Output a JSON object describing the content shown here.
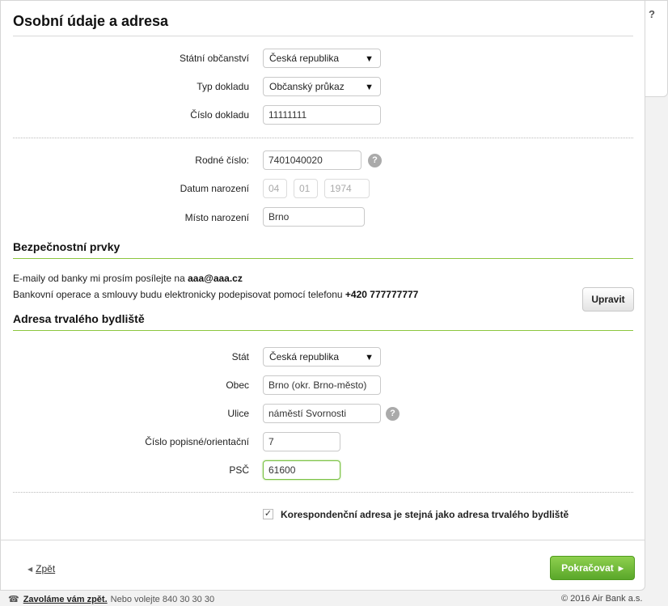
{
  "header": {
    "title": "Osobní údaje a adresa",
    "help": "?"
  },
  "document": {
    "citizenship_label": "Státní občanství",
    "citizenship_value": "Česká republika",
    "doctype_label": "Typ dokladu",
    "doctype_value": "Občanský průkaz",
    "docnum_label": "Číslo dokladu",
    "docnum_value": "11111111"
  },
  "personal": {
    "birthnum_label": "Rodné číslo:",
    "birthnum_value": "7401040020",
    "birthnum_help": "?",
    "dob_label": "Datum narození",
    "dob_day": "04",
    "dob_month": "01",
    "dob_year": "1974",
    "birthplace_label": "Místo narození",
    "birthplace_value": "Brno"
  },
  "security": {
    "title": "Bezpečnostní prvky",
    "email_text": "E-maily od banky mi prosím posílejte na ",
    "email_value": "aaa@aaa.cz",
    "phone_text": "Bankovní operace a smlouvy budu elektronicky podepisovat pomocí telefonu ",
    "phone_value": "+420 777777777",
    "edit_button": "Upravit"
  },
  "address": {
    "title": "Adresa trvalého bydliště",
    "country_label": "Stát",
    "country_value": "Česká republika",
    "city_label": "Obec",
    "city_value": "Brno (okr. Brno-město)",
    "street_label": "Ulice",
    "street_value": "náměstí Svornosti",
    "street_help": "?",
    "housenum_label": "Číslo popisné/orientační",
    "housenum_value": "7",
    "zip_label": "PSČ",
    "zip_value": "61600",
    "same_address_label": "Korespondenční adresa je stejná jako adresa trvalého bydliště",
    "same_address_checked": true
  },
  "nav": {
    "back": "Zpět",
    "continue": "Pokračovat"
  },
  "footer": {
    "callback": "Zavoláme vám zpět.",
    "or_call": "Nebo volejte 840 30 30 30",
    "copyright": "© 2016 Air Bank a.s."
  },
  "colors": {
    "accent_green": "#79c143",
    "button_green": "#5aa72a",
    "divider_green": "#8cc63f"
  }
}
